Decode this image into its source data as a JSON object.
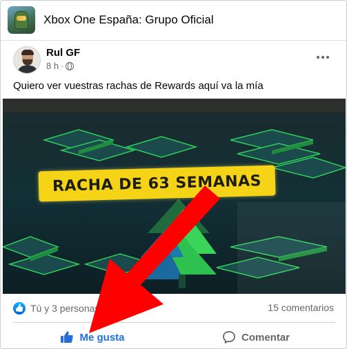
{
  "group": {
    "name": "Xbox One España: Grupo Oficial",
    "avatar_icon": "halo-helmet-icon"
  },
  "post": {
    "author": "Rul GF",
    "time": "8 h",
    "separator": "·",
    "audience_icon": "globe-icon",
    "text": "Quiero ver vuestras rachas de Rewards aquí va la mía",
    "image_banner_text": "RACHA DE 63 SEMANAS",
    "more_icon": "more-dots-icon"
  },
  "reactions": {
    "icon": "like-reaction-icon",
    "summary": "Tú y 3 personas m",
    "comments": "15 comentarios"
  },
  "actions": {
    "like_label": "Me gusta",
    "comment_label": "Comentar"
  },
  "colors": {
    "like_blue": "#216fdb",
    "banner_yellow": "#f5d316",
    "arrow_red": "#ff0000",
    "tile_green": "#2fd05a"
  }
}
